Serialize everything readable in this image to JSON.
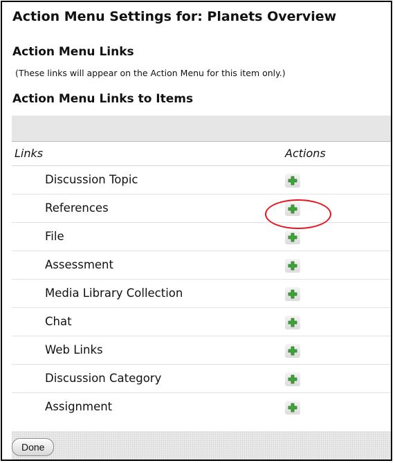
{
  "page_title": "Action Menu Settings for: Planets Overview",
  "section_links": {
    "heading": "Action Menu Links",
    "note": "(These links will appear on the Action Menu for this item only.)"
  },
  "section_items": {
    "heading": "Action Menu Links to Items"
  },
  "table": {
    "col_links": "Links",
    "col_actions": "Actions",
    "rows": [
      {
        "label": "Discussion Topic",
        "action_icon": "add-icon"
      },
      {
        "label": "References",
        "action_icon": "add-icon"
      },
      {
        "label": "File",
        "action_icon": "add-icon"
      },
      {
        "label": "Assessment",
        "action_icon": "add-icon"
      },
      {
        "label": "Media Library Collection",
        "action_icon": "add-icon"
      },
      {
        "label": "Chat",
        "action_icon": "add-icon"
      },
      {
        "label": "Web Links",
        "action_icon": "add-icon"
      },
      {
        "label": "Discussion Category",
        "action_icon": "add-icon"
      },
      {
        "label": "Assignment",
        "action_icon": "add-icon"
      }
    ]
  },
  "highlighted_row": "References",
  "footer": {
    "done_label": "Done"
  },
  "colors": {
    "add_green": "#3fa33a",
    "highlight_red": "#e8141e",
    "header_bar_grey": "#e6e6e6"
  }
}
